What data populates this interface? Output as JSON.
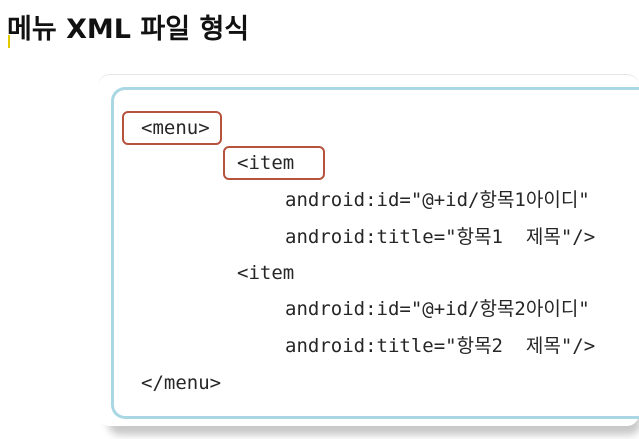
{
  "slide": {
    "title": "메뉴 XML 파일 형식"
  },
  "code": {
    "lines": [
      "<menu>",
      "<item",
      "android:id=\"@+id/항목1아이디\"",
      "android:title=\"항목1  제목\"/>",
      "<item",
      "android:id=\"@+id/항목2아이디\"",
      "android:title=\"항목2  제목\"/>",
      "</menu>"
    ]
  },
  "colors": {
    "highlight_border": "#b5533d",
    "frame_border": "#a9d7e4",
    "title_accent": "#e2c900"
  }
}
